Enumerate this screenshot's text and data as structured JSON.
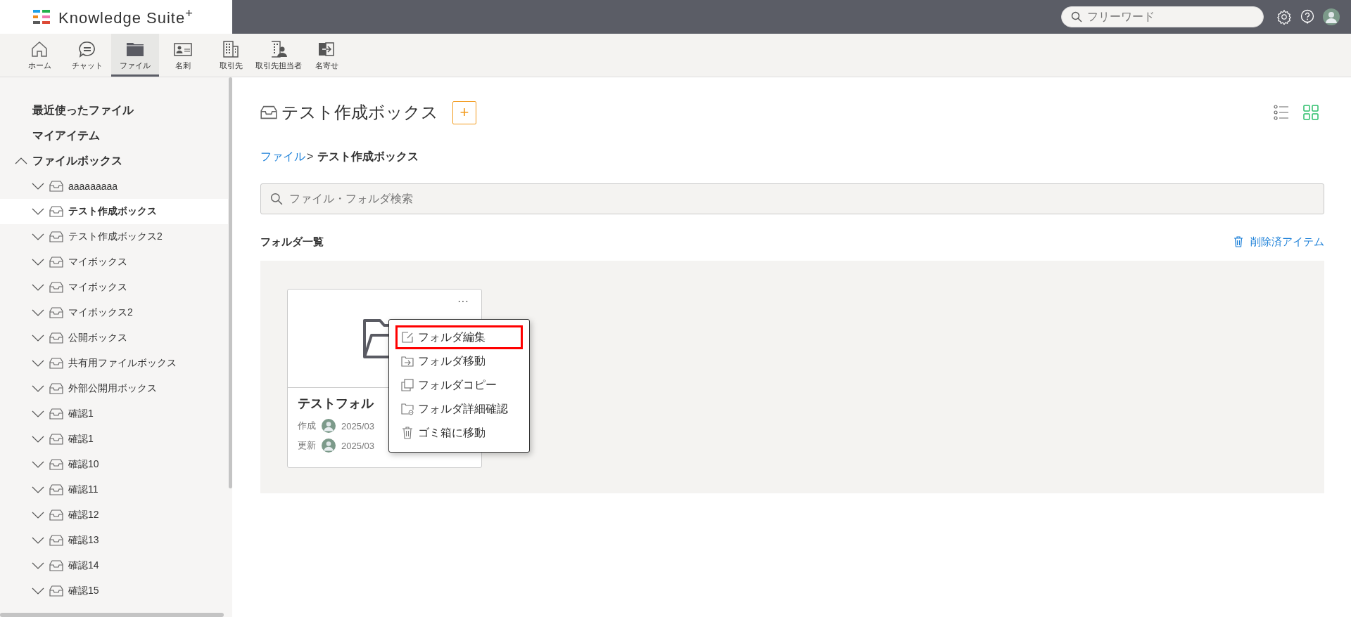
{
  "header": {
    "logo": "Knowledge Suite$^{+}$",
    "search": {
      "placeholder": "フリーワード"
    }
  },
  "nav": [
    {
      "label": "ホーム",
      "kind": "home",
      "selected": false
    },
    {
      "label": "チャット",
      "kind": "chat",
      "selected": false
    },
    {
      "label": "ファイル",
      "kind": "folder",
      "selected": true
    },
    {
      "label": "名刺",
      "kind": "card",
      "selected": false
    },
    {
      "label": "取引先",
      "kind": "building",
      "selected": false
    },
    {
      "label": "取引先担当者",
      "kind": "contact",
      "selected": false
    },
    {
      "label": "名寄せ",
      "kind": "merge",
      "selected": false
    }
  ],
  "sidebar": {
    "items": [
      {
        "label": "最近使ったファイル"
      },
      {
        "label": "マイアイテム"
      },
      {
        "label": "ファイルボックス",
        "expanded": true,
        "children": [
          {
            "label": "aaaaaaaaa",
            "expanded": false,
            "selected": false
          },
          {
            "label": "テスト作成ボックス",
            "expanded": false,
            "selected": true
          },
          {
            "label": "テスト作成ボックス2",
            "expanded": false,
            "selected": false
          },
          {
            "label": "マイボックス",
            "expanded": false,
            "selected": false
          },
          {
            "label": "マイボックス",
            "expanded": false,
            "selected": false
          },
          {
            "label": "マイボックス2",
            "expanded": false,
            "selected": false
          },
          {
            "label": "公開ボックス",
            "expanded": false,
            "selected": false
          },
          {
            "label": "共有用ファイルボックス",
            "expanded": false,
            "selected": false
          },
          {
            "label": "外部公開用ボックス",
            "expanded": false,
            "selected": false
          },
          {
            "label": "確認1",
            "expanded": false,
            "selected": false
          },
          {
            "label": "確認1",
            "expanded": false,
            "selected": false
          },
          {
            "label": "確認10",
            "expanded": false,
            "selected": false
          },
          {
            "label": "確認11",
            "expanded": false,
            "selected": false
          },
          {
            "label": "確認12",
            "expanded": false,
            "selected": false
          },
          {
            "label": "確認13",
            "expanded": false,
            "selected": false
          },
          {
            "label": "確認14",
            "expanded": false,
            "selected": false
          },
          {
            "label": "確認15",
            "expanded": false,
            "selected": false
          }
        ]
      }
    ]
  },
  "page": {
    "title": "テスト作成ボックス",
    "add_button": "+",
    "views": [
      {
        "kind": "list",
        "selected": false
      },
      {
        "kind": "grid",
        "selected": true
      }
    ],
    "breadcrumb": [
      {
        "label": "ファイル",
        "kind": "link"
      },
      {
        "label": ">",
        "kind": "separator"
      },
      {
        "label": "テスト作成ボックス",
        "kind": "current"
      }
    ],
    "search": {
      "placeholder": "ファイル・フォルダ検索"
    },
    "section_title": "フォルダ一覧",
    "deleted_link": "削除済アイテム",
    "folders": [
      {
        "name": "テストフォル",
        "more": "···",
        "meta": [
          {
            "label": "作成",
            "date": "2025/03"
          },
          {
            "label": "更新",
            "date": "2025/03"
          }
        ]
      }
    ],
    "context_menu": [
      {
        "label": "フォルダ編集",
        "kind": "edit",
        "selected": true
      },
      {
        "label": "フォルダ移動",
        "kind": "move",
        "selected": false
      },
      {
        "label": "フォルダコピー",
        "kind": "copy",
        "selected": false
      },
      {
        "label": "フォルダ詳細確認",
        "kind": "details",
        "selected": false
      },
      {
        "label": "ゴミ箱に移動",
        "kind": "trash",
        "selected": false
      }
    ]
  }
}
